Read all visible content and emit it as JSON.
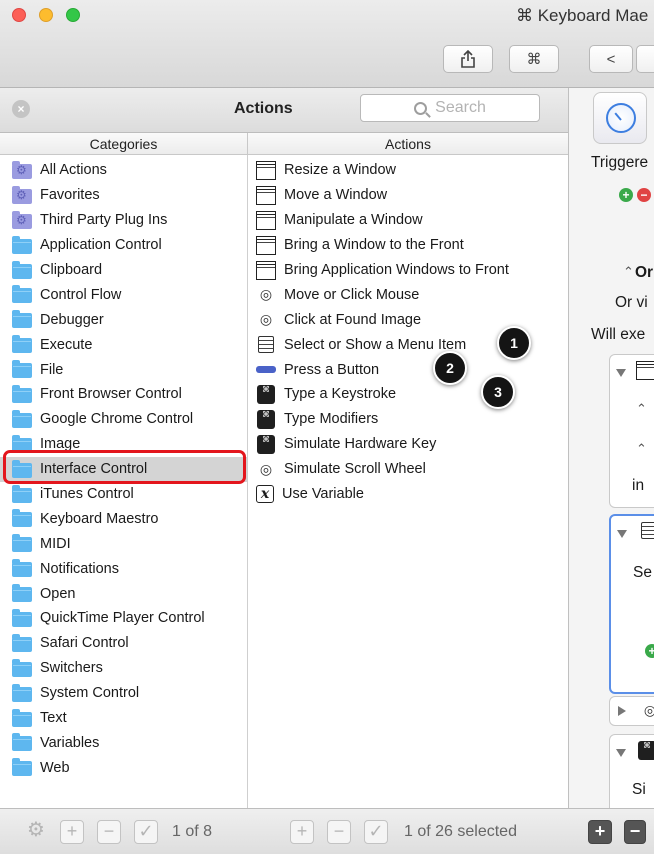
{
  "window": {
    "title": "⌘ Keyboard Mae",
    "toolbar": {
      "share_icon": "share-icon",
      "cmd_label": "⌘",
      "back_label": "<"
    }
  },
  "panel": {
    "title": "Actions",
    "search_placeholder": "Search",
    "categories_header": "Categories",
    "actions_header": "Actions"
  },
  "categories": [
    {
      "label": "All Actions",
      "icon": "smart-folder-icon"
    },
    {
      "label": "Favorites",
      "icon": "smart-folder-icon"
    },
    {
      "label": "Third Party Plug Ins",
      "icon": "smart-folder-icon"
    },
    {
      "label": "Application Control",
      "icon": "folder-icon"
    },
    {
      "label": "Clipboard",
      "icon": "folder-icon"
    },
    {
      "label": "Control Flow",
      "icon": "folder-icon"
    },
    {
      "label": "Debugger",
      "icon": "folder-icon"
    },
    {
      "label": "Execute",
      "icon": "folder-icon"
    },
    {
      "label": "File",
      "icon": "folder-icon"
    },
    {
      "label": "Front Browser Control",
      "icon": "folder-icon"
    },
    {
      "label": "Google Chrome Control",
      "icon": "folder-icon"
    },
    {
      "label": "Image",
      "icon": "folder-icon"
    },
    {
      "label": "Interface Control",
      "icon": "folder-icon",
      "selected": true
    },
    {
      "label": "iTunes Control",
      "icon": "folder-icon"
    },
    {
      "label": "Keyboard Maestro",
      "icon": "folder-icon"
    },
    {
      "label": "MIDI",
      "icon": "folder-icon"
    },
    {
      "label": "Notifications",
      "icon": "folder-icon"
    },
    {
      "label": "Open",
      "icon": "folder-icon"
    },
    {
      "label": "QuickTime Player Control",
      "icon": "folder-icon"
    },
    {
      "label": "Safari Control",
      "icon": "folder-icon"
    },
    {
      "label": "Switchers",
      "icon": "folder-icon"
    },
    {
      "label": "System Control",
      "icon": "folder-icon"
    },
    {
      "label": "Text",
      "icon": "folder-icon"
    },
    {
      "label": "Variables",
      "icon": "folder-icon"
    },
    {
      "label": "Web",
      "icon": "folder-icon"
    }
  ],
  "actions": [
    {
      "label": "Resize a Window",
      "icon": "window-icon"
    },
    {
      "label": "Move a Window",
      "icon": "window-icon"
    },
    {
      "label": "Manipulate a Window",
      "icon": "window-icon"
    },
    {
      "label": "Bring a Window to the Front",
      "icon": "window-icon"
    },
    {
      "label": "Bring Application Windows to Front",
      "icon": "window-icon"
    },
    {
      "label": "Move or Click Mouse",
      "icon": "mouse-click-icon"
    },
    {
      "label": "Click at Found Image",
      "icon": "mouse-click-icon"
    },
    {
      "label": "Select or Show a Menu Item",
      "icon": "menu-icon"
    },
    {
      "label": "Press a Button",
      "icon": "button-icon"
    },
    {
      "label": "Type a Keystroke",
      "icon": "keystroke-icon"
    },
    {
      "label": "Type Modifiers",
      "icon": "keystroke-icon"
    },
    {
      "label": "Simulate Hardware Key",
      "icon": "keystroke-icon"
    },
    {
      "label": "Simulate Scroll Wheel",
      "icon": "mouse-click-icon"
    },
    {
      "label": "Use Variable",
      "icon": "variable-icon"
    }
  ],
  "callouts": [
    "1",
    "2",
    "3"
  ],
  "footer": {
    "categories_count": "1 of 8",
    "actions_count": "1 of 26 selected",
    "add_label": "+",
    "remove_label": "−",
    "check_label": "✓"
  },
  "editor": {
    "triggered_text": "Triggere",
    "or_text": "Or",
    "or_vi_text": "Or vi",
    "will_exec_text": "Will exe",
    "in_text": "in",
    "se_text": "Se",
    "si_text": "Si"
  },
  "colors": {
    "highlight": "#e3161d",
    "selected_row": "#d4d4d4",
    "folder": "#5eb7ef",
    "smart_folder": "#9a9be0"
  }
}
